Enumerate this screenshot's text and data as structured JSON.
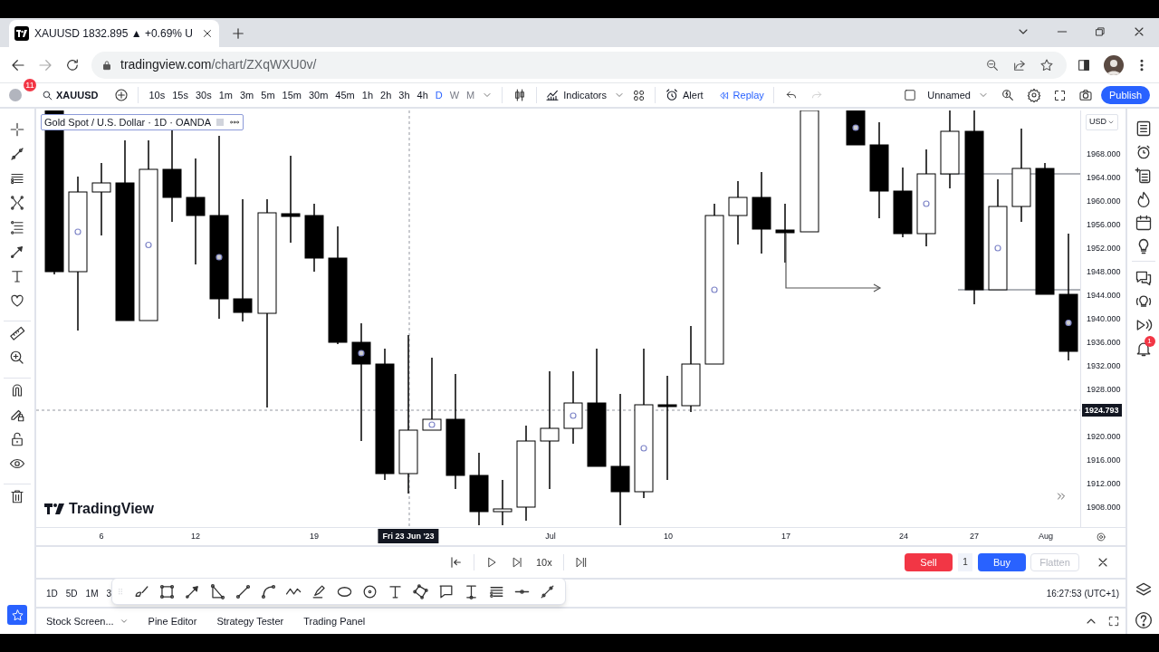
{
  "browser": {
    "tab_title": "XAUUSD 1832.895 ▲ +0.69% U",
    "url_domain": "tradingview.com",
    "url_path": "/chart/ZXqWXU0v/"
  },
  "toolbar": {
    "notification_count": "11",
    "symbol": "XAUUSD",
    "intervals": [
      {
        "label": "10s",
        "selected": false
      },
      {
        "label": "15s",
        "selected": false
      },
      {
        "label": "30s",
        "selected": false
      },
      {
        "label": "1m",
        "selected": false
      },
      {
        "label": "3m",
        "selected": false
      },
      {
        "label": "5m",
        "selected": false
      },
      {
        "label": "15m",
        "selected": false
      },
      {
        "label": "30m",
        "selected": false
      },
      {
        "label": "45m",
        "selected": false
      },
      {
        "label": "1h",
        "selected": false
      },
      {
        "label": "2h",
        "selected": false
      },
      {
        "label": "3h",
        "selected": false
      },
      {
        "label": "4h",
        "selected": false
      },
      {
        "label": "D",
        "selected": true
      },
      {
        "label": "W",
        "selected": false
      },
      {
        "label": "M",
        "selected": false
      }
    ],
    "indicators": "Indicators",
    "alert": "Alert",
    "replay": "Replay",
    "layout_name": "Unnamed",
    "publish": "Publish"
  },
  "chart": {
    "legend": "Gold Spot / U.S. Dollar · 1D · OANDA",
    "logo": "TradingView",
    "currency": "USD",
    "price_ticks": [
      "1968.000",
      "1964.000",
      "1960.000",
      "1956.000",
      "1952.000",
      "1948.000",
      "1944.000",
      "1940.000",
      "1936.000",
      "1932.000",
      "1928.000",
      "1920.000",
      "1916.000",
      "1912.000",
      "1908.000"
    ],
    "current_price": "1924.793",
    "time_ticks": [
      {
        "label": "6",
        "highlighted": false
      },
      {
        "label": "12",
        "highlighted": false
      },
      {
        "label": "19",
        "highlighted": false
      },
      {
        "label": "Fri 23 Jun '23",
        "highlighted": true
      },
      {
        "label": "Jul",
        "highlighted": false
      },
      {
        "label": "10",
        "highlighted": false
      },
      {
        "label": "17",
        "highlighted": false
      },
      {
        "label": "24",
        "highlighted": false
      },
      {
        "label": "27",
        "highlighted": false
      },
      {
        "label": "Aug",
        "highlighted": false
      }
    ]
  },
  "replay_bar": {
    "speed": "10x",
    "sell": "Sell",
    "quantity": "1",
    "buy": "Buy",
    "flatten": "Flatten"
  },
  "ranges": [
    "1D",
    "5D",
    "1M",
    "3"
  ],
  "clock": "16:27:53 (UTC+1)",
  "bottom_tabs": [
    "Stock Screen...",
    "Pine Editor",
    "Strategy Tester",
    "Trading Panel"
  ],
  "alerts_badge": "1"
}
